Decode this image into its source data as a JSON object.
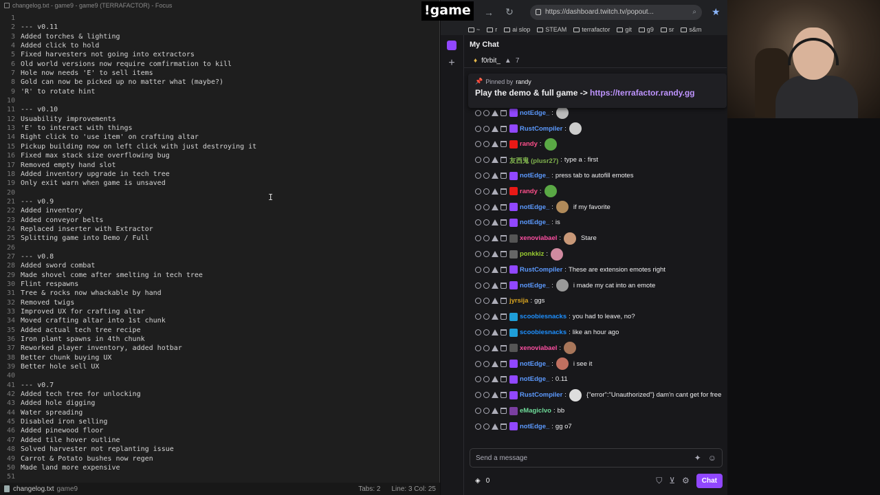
{
  "editor": {
    "title": "changelog.txt - game9 - game9 (TERRAFACTOR) - Focus",
    "lines": [
      "",
      "--- v0.11",
      "Added torches & lighting",
      "Added click to hold",
      "Fixed harvesters not going into extractors",
      "Old world versions now require comfirmation to kill",
      "Hole now needs 'E' to sell items",
      "Gold can now be picked up no matter what (maybe?)",
      "'R' to rotate hint",
      "",
      "--- v0.10",
      "Usuability improvements",
      "'E' to interact with things",
      "Right click to 'use item' on crafting altar",
      "Pickup building now on left click with just destroying it",
      "Fixed max stack size overflowing bug",
      "Removed empty hand slot",
      "Added inventory upgrade in tech tree",
      "Only exit warn when game is unsaved",
      "",
      "--- v0.9",
      "Added inventory",
      "Added conveyor belts",
      "Replaced inserter with Extractor",
      "Splitting game into Demo / Full",
      "",
      "--- v0.8",
      "Added sword combat",
      "Made shovel come after smelting in tech tree",
      "Flint respawns",
      "Tree & rocks now whackable by hand",
      "Removed twigs",
      "Improved UX for crafting altar",
      "Moved crafting altar into 1st chunk",
      "Added actual tech tree recipe",
      "Iron plant spawns in 4th chunk",
      "Reworked player inventory, added hotbar",
      "Better chunk buying UX",
      "Better hole sell UX",
      "",
      "--- v0.7",
      "Added tech tree for unlocking",
      "Added hole digging",
      "Water spreading",
      "Disabled iron selling",
      "Added pinewood floor",
      "Added tile hover outline",
      "Solved harvester not replanting issue",
      "Carrot & Potato bushes now regen",
      "Made land more expensive",
      ""
    ],
    "caret_glyph": "I",
    "status": {
      "file": "changelog.txt",
      "project": "game9",
      "tabs": "Tabs: 2",
      "position": "Line: 3  Col: 25"
    }
  },
  "overlay": {
    "command": "!game"
  },
  "browser": {
    "url": "https://dashboard.twitch.tv/popout...",
    "bookmarks": [
      "~",
      "r",
      "ai slop",
      "STEAM",
      "terrafactor",
      "git",
      "g9",
      "sr",
      "s&m"
    ]
  },
  "chat": {
    "header": "My Chat",
    "gift_user": "f0rbit_",
    "gift_count": "7",
    "pinned": {
      "by_label": "Pinned by",
      "by_user": "randy",
      "text": "Play the demo & full game -> ",
      "link": "https://terrafactor.randy.gg"
    },
    "messages": [
      {
        "user": "notEdge_",
        "color": "#5c9aff",
        "badge": "#9147ff",
        "text": "",
        "emote": "#bbb"
      },
      {
        "user": "RustCompiler",
        "color": "#5c9aff",
        "badge": "#9147ff",
        "text": "",
        "emote": "#ccc"
      },
      {
        "user": "randy",
        "color": "#ff4f8b",
        "badge": "#e91916",
        "text": "",
        "emote": "#5aa845"
      },
      {
        "user": "友西鬼 (plusr27)",
        "color": "#7fb24d",
        "badge": "",
        "text": "type a : first",
        "emote": ""
      },
      {
        "user": "notEdge_",
        "color": "#5c9aff",
        "badge": "#9147ff",
        "text": "press tab to autofill emotes",
        "emote": ""
      },
      {
        "user": "randy",
        "color": "#ff4f8b",
        "badge": "#e91916",
        "text": "",
        "emote": "#5aa845"
      },
      {
        "user": "notEdge_",
        "color": "#5c9aff",
        "badge": "#9147ff",
        "text": "if my favorite",
        "emote": "#b08a5a"
      },
      {
        "user": "notEdge_",
        "color": "#5c9aff",
        "badge": "#9147ff",
        "text": "is",
        "emote": ""
      },
      {
        "user": "xenoviabael",
        "color": "#ff4fa3",
        "badge": "#555",
        "text": "Stare",
        "emote": "#c89878"
      },
      {
        "user": "ponkkiz",
        "color": "#9acd32",
        "badge": "#666",
        "text": "",
        "emote": "#d08aa0"
      },
      {
        "user": "RustCompiler",
        "color": "#5c9aff",
        "badge": "#9147ff",
        "text": "These are extension emotes right",
        "emote": ""
      },
      {
        "user": "notEdge_",
        "color": "#5c9aff",
        "badge": "#9147ff",
        "text": "i made my cat into an emote",
        "emote": "#999"
      },
      {
        "user": "jyrsija",
        "color": "#daa520",
        "badge": "",
        "text": "ggs",
        "emote": ""
      },
      {
        "user": "scoobiesnacks",
        "color": "#1e90ff",
        "badge": "#1f9ed8",
        "text": "you had to leave, no?",
        "emote": ""
      },
      {
        "user": "scoobiesnacks",
        "color": "#1e90ff",
        "badge": "#1f9ed8",
        "text": "like an hour ago",
        "emote": ""
      },
      {
        "user": "xenoviabael",
        "color": "#ff4fa3",
        "badge": "#555",
        "text": "",
        "emote": "#a8765a"
      },
      {
        "user": "notEdge_",
        "color": "#5c9aff",
        "badge": "#9147ff",
        "text": "i see it",
        "emote": "#c07060"
      },
      {
        "user": "notEdge_",
        "color": "#5c9aff",
        "badge": "#9147ff",
        "text": "0.11",
        "emote": ""
      },
      {
        "user": "RustCompiler",
        "color": "#5c9aff",
        "badge": "#9147ff",
        "text": "{\"error\":\"Unauthorized\"} dam'n cant get for free",
        "emote": "#ddd"
      },
      {
        "user": "eMagiclvo",
        "color": "#6fdc9a",
        "badge": "#7a3ea0",
        "text": "bb",
        "emote": ""
      },
      {
        "user": "notEdge_",
        "color": "#5c9aff",
        "badge": "#9147ff",
        "text": "gg o7",
        "emote": ""
      }
    ],
    "input_placeholder": "Send a message",
    "points": "0",
    "chat_button": "Chat"
  }
}
